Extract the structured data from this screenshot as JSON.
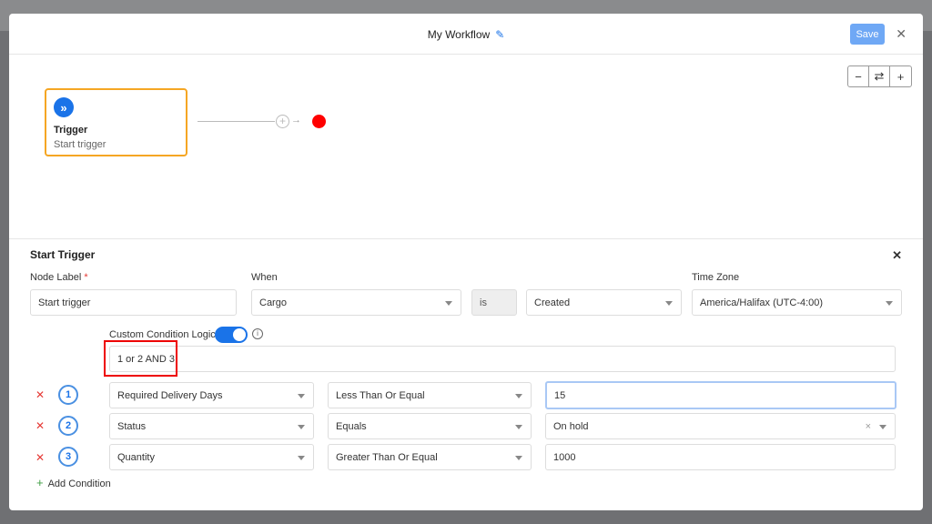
{
  "modal": {
    "title": "My Workflow",
    "save_label": "Save"
  },
  "canvas": {
    "zoom_out": "−",
    "reset": "⇄",
    "zoom_in": "+",
    "node": {
      "title": "Trigger",
      "subtitle": "Start trigger"
    }
  },
  "panel": {
    "title": "Start Trigger",
    "node_label": {
      "label": "Node Label",
      "required": "*",
      "value": "Start trigger"
    },
    "when": {
      "label": "When",
      "value": "Cargo",
      "operator": "is",
      "event": "Created"
    },
    "timezone": {
      "label": "Time Zone",
      "value": "America/Halifax (UTC-4:00)"
    },
    "custom_logic": {
      "label": "Custom Condition Logics",
      "enabled": true,
      "value": "1 or 2 AND 3"
    },
    "conditions": [
      {
        "num": "1",
        "field": "Required Delivery Days",
        "operator": "Less Than Or Equal",
        "value": "15"
      },
      {
        "num": "2",
        "field": "Status",
        "operator": "Equals",
        "value": "On hold"
      },
      {
        "num": "3",
        "field": "Quantity",
        "operator": "Greater Than Or Equal",
        "value": "1000"
      }
    ],
    "add_condition": "Add Condition"
  },
  "colors": {
    "accent": "#1a73e8",
    "node_border": "#f5a623",
    "highlight": "#e00000"
  }
}
